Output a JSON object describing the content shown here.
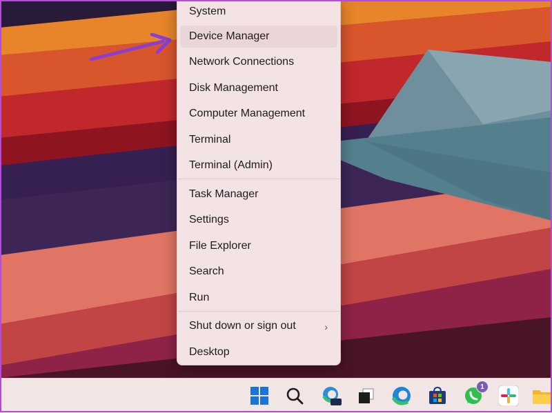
{
  "menu": {
    "items": [
      {
        "label": "System"
      },
      {
        "label": "Device Manager"
      },
      {
        "label": "Network Connections"
      },
      {
        "label": "Disk Management"
      },
      {
        "label": "Computer Management"
      },
      {
        "label": "Terminal"
      },
      {
        "label": "Terminal (Admin)"
      },
      {
        "label": "Task Manager"
      },
      {
        "label": "Settings"
      },
      {
        "label": "File Explorer"
      },
      {
        "label": "Search"
      },
      {
        "label": "Run"
      },
      {
        "label": "Shut down or sign out"
      },
      {
        "label": "Desktop"
      }
    ],
    "highlighted": "Device Manager"
  },
  "taskbar": {
    "icons": [
      {
        "name": "windows-start-icon"
      },
      {
        "name": "search-icon"
      },
      {
        "name": "edge-preview-icon",
        "tag": "PRE"
      },
      {
        "name": "task-view-icon"
      },
      {
        "name": "edge-icon"
      },
      {
        "name": "microsoft-store-icon"
      },
      {
        "name": "whatsapp-icon",
        "badge": "1"
      },
      {
        "name": "slack-icon"
      },
      {
        "name": "file-explorer-icon"
      }
    ]
  },
  "colors": {
    "accent_arrow": "#8a3fd1",
    "menu_bg": "#f4e3e4",
    "taskbar_bg": "#f2e5e6"
  }
}
